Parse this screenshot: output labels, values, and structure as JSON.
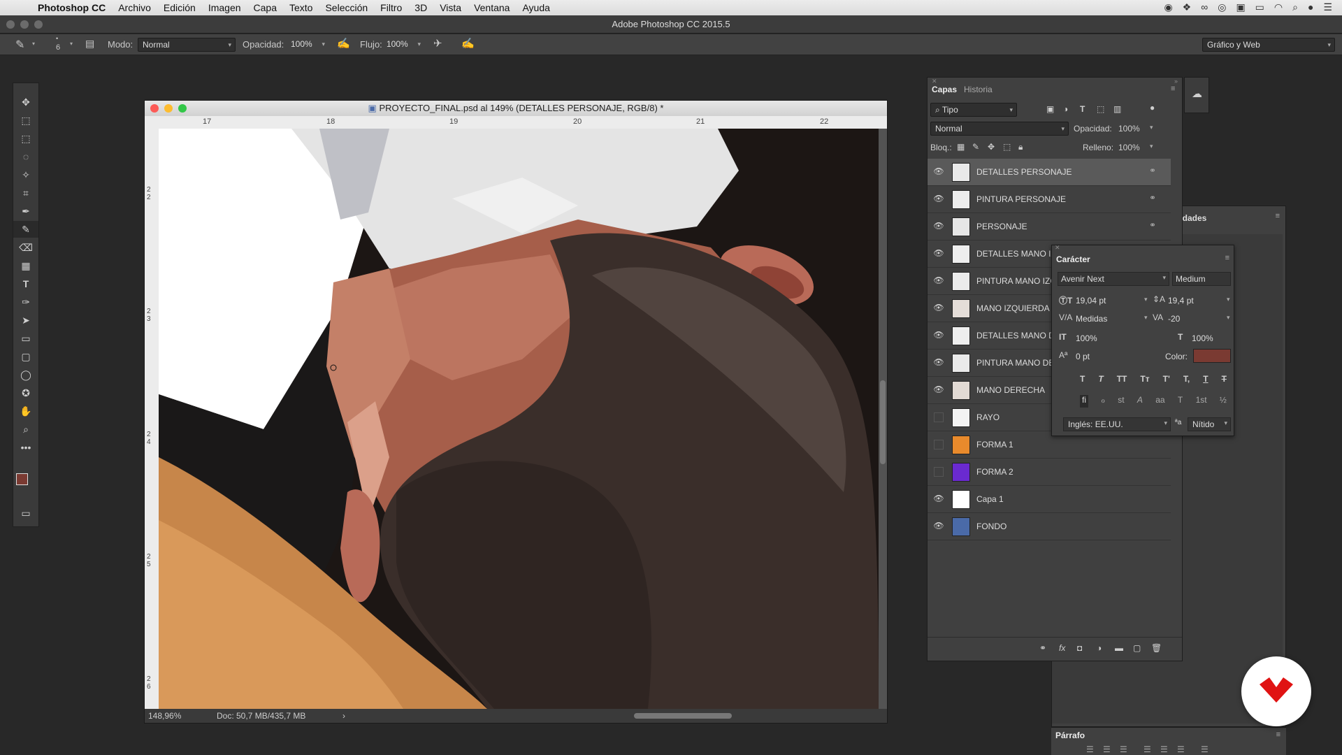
{
  "menubar": {
    "app": "Photoshop CC",
    "items": [
      "Archivo",
      "Edición",
      "Imagen",
      "Capa",
      "Texto",
      "Selección",
      "Filtro",
      "3D",
      "Vista",
      "Ventana",
      "Ayuda"
    ]
  },
  "window": {
    "title": "Adobe Photoshop CC 2015.5"
  },
  "options": {
    "brush_size": "6",
    "mode_label": "Modo:",
    "mode_value": "Normal",
    "opacity_label": "Opacidad:",
    "opacity_value": "100%",
    "flow_label": "Flujo:",
    "flow_value": "100%",
    "workspace": "Gráfico y Web"
  },
  "document": {
    "title": "PROYECTO_FINAL.psd al 149% (DETALLES PERSONAJE, RGB/8) *",
    "ruler_top": [
      "17",
      "18",
      "19",
      "20",
      "21",
      "22"
    ],
    "ruler_left": [
      "2\n2",
      "2\n3",
      "2\n4",
      "2\n5",
      "2\n6"
    ],
    "zoom": "148,96%",
    "doc_info": "Doc: 50,7 MB/435,7 MB",
    "status_arrow": "›"
  },
  "layers_panel": {
    "tabs": [
      "Capas",
      "Historia"
    ],
    "filter": "Tipo",
    "blend_mode": "Normal",
    "opacity_label": "Opacidad:",
    "opacity_value": "100%",
    "lock_label": "Bloq.:",
    "fill_label": "Relleno:",
    "fill_value": "100%",
    "layers": [
      {
        "name": "DETALLES PERSONAJE",
        "visible": true,
        "linked": true,
        "selected": true,
        "thumb": "#e9e9e9"
      },
      {
        "name": "PINTURA PERSONAJE",
        "visible": true,
        "linked": true,
        "selected": false,
        "thumb": "#ededed"
      },
      {
        "name": "PERSONAJE",
        "visible": true,
        "linked": true,
        "selected": false,
        "thumb": "#e6e6e6"
      },
      {
        "name": "DETALLES MANO IZ",
        "visible": true,
        "linked": false,
        "selected": false,
        "thumb": "#eeeeee"
      },
      {
        "name": "PINTURA MANO IZC",
        "visible": true,
        "linked": false,
        "selected": false,
        "thumb": "#ebebeb"
      },
      {
        "name": "MANO IZQUIERDA",
        "visible": true,
        "linked": false,
        "selected": false,
        "thumb": "#e4ddd8"
      },
      {
        "name": "DETALLES MANO D",
        "visible": true,
        "linked": false,
        "selected": false,
        "thumb": "#eeeeee"
      },
      {
        "name": "PINTURA MANO DE",
        "visible": true,
        "linked": false,
        "selected": false,
        "thumb": "#eaeaea"
      },
      {
        "name": "MANO DERECHA",
        "visible": true,
        "linked": false,
        "selected": false,
        "thumb": "#e2dad4"
      },
      {
        "name": "RAYO",
        "visible": false,
        "linked": false,
        "selected": false,
        "thumb": "#f3f3f3"
      },
      {
        "name": "FORMA 1",
        "visible": false,
        "linked": false,
        "selected": false,
        "thumb": "#e88a2c"
      },
      {
        "name": "FORMA 2",
        "visible": false,
        "linked": false,
        "selected": false,
        "thumb": "#6a2ad0"
      },
      {
        "name": "Capa 1",
        "visible": true,
        "linked": false,
        "selected": false,
        "thumb": "#ffffff"
      },
      {
        "name": "FONDO",
        "visible": true,
        "linked": false,
        "selected": false,
        "thumb": "#4a6aa8"
      }
    ]
  },
  "properties_panel": {
    "title_fragment": "edades"
  },
  "character_panel": {
    "title": "Carácter",
    "font_family": "Avenir Next",
    "font_style": "Medium",
    "font_size": "19,04 pt",
    "leading": "19,4 pt",
    "kerning": "Medidas",
    "tracking": "-20",
    "vertical_scale": "100%",
    "horizontal_scale": "100%",
    "baseline_shift": "0 pt",
    "color_label": "Color:",
    "color_value": "#7a3a32",
    "style_buttons": [
      "T",
      "T",
      "TT",
      "Tт",
      "T'",
      "T,",
      "T",
      "T"
    ],
    "opentype_buttons": [
      "ﬁ",
      "ℴ",
      "st",
      "A",
      "aa",
      "T",
      "1st",
      "½"
    ],
    "language": "Inglés: EE.UU.",
    "aa_label": "ªa",
    "antialias": "Nítido"
  },
  "paragraph_panel": {
    "title": "Párrafo"
  }
}
